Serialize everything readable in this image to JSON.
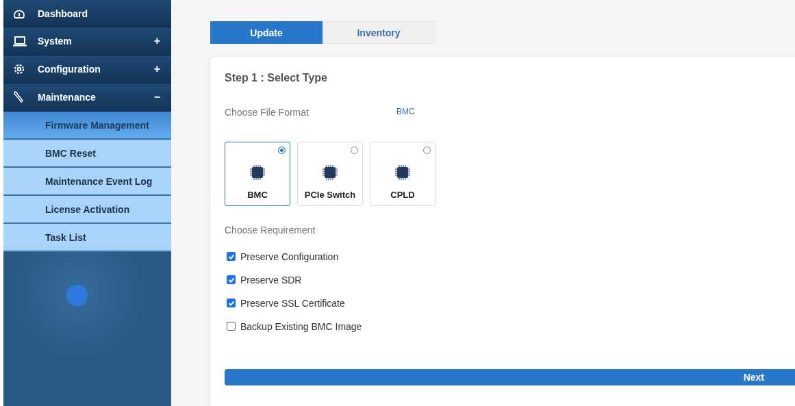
{
  "sidebar": {
    "menu": [
      {
        "label": "Dashboard"
      },
      {
        "label": "System",
        "toggle": "+"
      },
      {
        "label": "Configuration",
        "toggle": "+"
      },
      {
        "label": "Maintenance",
        "toggle": "−",
        "children": [
          {
            "label": "Firmware Management",
            "selected": true
          },
          {
            "label": "BMC Reset",
            "selected": false
          },
          {
            "label": "Maintenance Event Log",
            "selected": false
          },
          {
            "label": "License Activation",
            "selected": false
          },
          {
            "label": "Task List",
            "selected": false
          }
        ]
      }
    ]
  },
  "tabs": [
    {
      "label": "Update",
      "selected": true
    },
    {
      "label": "Inventory",
      "selected": false
    }
  ],
  "step_title": "Step 1 : Select Type",
  "file_format": {
    "label": "Choose File Format",
    "value": "BMC"
  },
  "types": [
    {
      "label": "BMC",
      "selected": true
    },
    {
      "label": "PCIe Switch",
      "selected": false
    },
    {
      "label": "CPLD",
      "selected": false
    }
  ],
  "requirement_label": "Choose Requirement",
  "requirements": [
    {
      "label": "Preserve Configuration",
      "checked": true
    },
    {
      "label": "Preserve SDR",
      "checked": true
    },
    {
      "label": "Preserve SSL Certificate",
      "checked": true
    },
    {
      "label": "Backup Existing BMC Image",
      "checked": false
    }
  ],
  "next_button": "Next"
}
